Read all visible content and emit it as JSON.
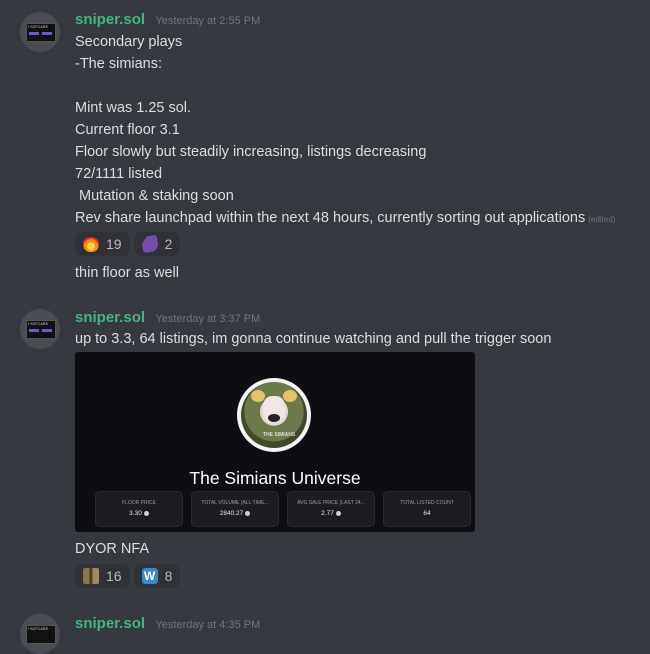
{
  "messages": [
    {
      "username": "sniper.sol",
      "timestamp": "Yesterday at 2:55 PM",
      "avatar_text": "I SCFCARE",
      "lines": [
        "Secondary plays",
        "-The simians:",
        "",
        "Mint was 1.25 sol.",
        "Current floor 3.1",
        "Floor slowly but steadily increasing, listings decreasing",
        "72/1111 listed",
        " Mutation & staking soon",
        "Rev share launchpad within the next 48 hours, currently sorting out applications"
      ],
      "edited_label": "(edited)",
      "reactions": [
        {
          "emoji": "fire-emoji",
          "count": "19"
        },
        {
          "emoji": "eggplant-emoji",
          "count": "2"
        }
      ],
      "followup": "thin floor as well"
    },
    {
      "username": "sniper.sol",
      "timestamp": "Yesterday at 3:37 PM",
      "avatar_text": "I SCFCARE",
      "text": "up to 3.3, 64 listings, im gonna continue watching and pull the trigger soon",
      "embed": {
        "logo_text": "THE SIMIANS",
        "title": "The Simians Universe",
        "stats": [
          {
            "label": "FLOOR PRICE",
            "value": "3.30"
          },
          {
            "label": "TOTAL VOLUME (ALL TIME...",
            "value": "2840.27"
          },
          {
            "label": "AVG SALE PRICE (LAST 24...",
            "value": "2.77"
          },
          {
            "label": "TOTAL LISTED COUNT",
            "value": "64"
          }
        ]
      },
      "followup": "DYOR NFA",
      "reactions": [
        {
          "emoji": "pixel-emoji",
          "count": "16"
        },
        {
          "emoji": "w-emoji",
          "count": "8",
          "glyph": "W"
        }
      ]
    },
    {
      "username": "sniper.sol",
      "timestamp": "Yesterday at 4:35 PM",
      "avatar_text": "I SCFCARE"
    }
  ],
  "colors": {
    "background": "#36393f",
    "username": "#43b581",
    "timestamp": "#72767d",
    "text": "#dcddde",
    "reaction_bg": "#2f3136"
  }
}
